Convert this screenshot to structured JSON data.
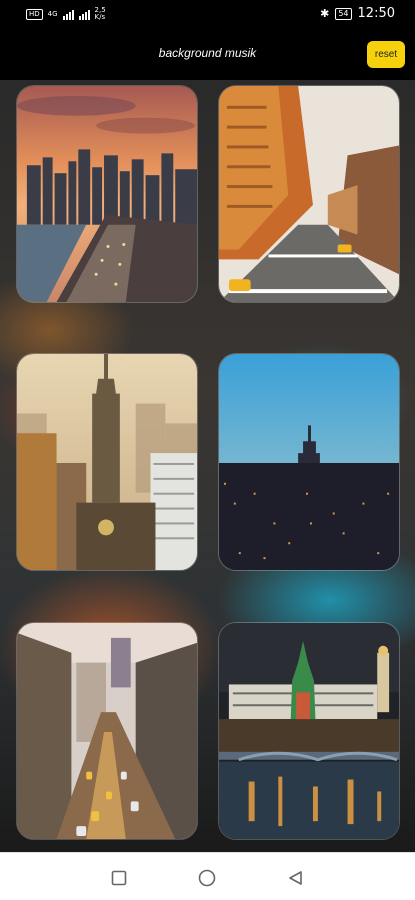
{
  "status": {
    "sim_badge": "HD",
    "network": "4G",
    "speed_value": "2,5",
    "speed_unit": "K/s",
    "battery": "54",
    "time": "12:50"
  },
  "header": {
    "title": "background musik",
    "reset_label": "reset",
    "reset_color": "#f5d20b"
  },
  "gallery": {
    "items": [
      {
        "scene": "sunset-skyline-highway"
      },
      {
        "scene": "golden-avenue-street"
      },
      {
        "scene": "empire-state-hazy"
      },
      {
        "scene": "twilight-skyline"
      },
      {
        "scene": "downtown-street-traffic"
      },
      {
        "scene": "kremlin-night"
      }
    ]
  },
  "navbar": {
    "recents_icon": "square-icon",
    "home_icon": "circle-icon",
    "back_icon": "triangle-back-icon"
  }
}
